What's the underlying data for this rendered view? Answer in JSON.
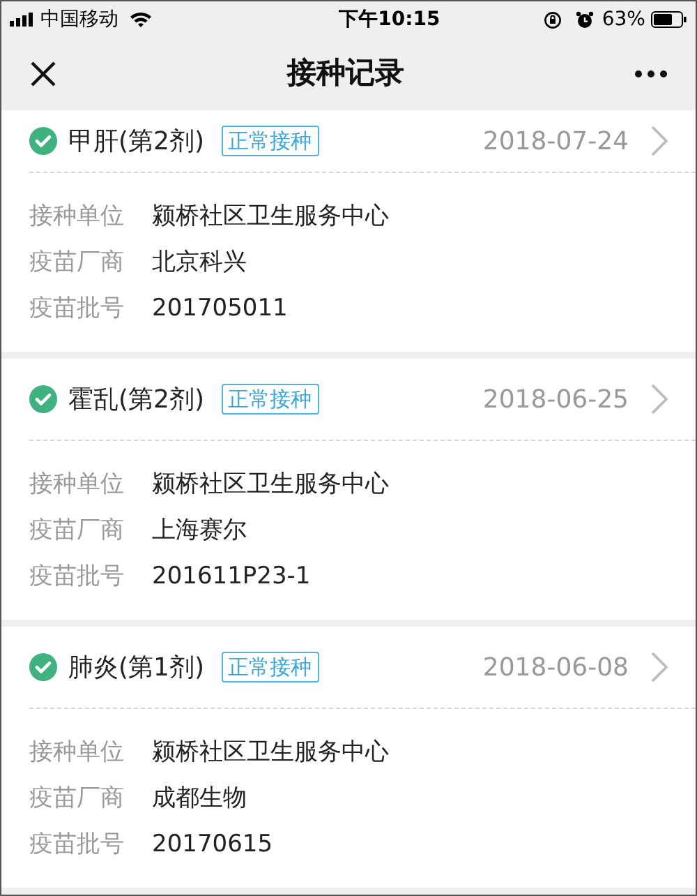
{
  "status_bar": {
    "carrier": "中国移动",
    "time": "下午10:15",
    "battery": "63%"
  },
  "nav": {
    "title": "接种记录"
  },
  "records": [
    {
      "name": "甲肝(第2剂)",
      "done": true,
      "tag": "正常接种",
      "date": "2018-07-24",
      "fields": [
        {
          "label": "接种单位",
          "value": "颍桥社区卫生服务中心"
        },
        {
          "label": "疫苗厂商",
          "value": "北京科兴"
        },
        {
          "label": "疫苗批号",
          "value": "201705011"
        }
      ]
    },
    {
      "name": "霍乱(第2剂)",
      "done": true,
      "tag": "正常接种",
      "date": "2018-06-25",
      "fields": [
        {
          "label": "接种单位",
          "value": "颍桥社区卫生服务中心"
        },
        {
          "label": "疫苗厂商",
          "value": "上海赛尔"
        },
        {
          "label": "疫苗批号",
          "value": "201611P23-1"
        }
      ]
    },
    {
      "name": "肺炎(第1剂)",
      "done": true,
      "tag": "正常接种",
      "date": "2018-06-08",
      "fields": [
        {
          "label": "接种单位",
          "value": "颍桥社区卫生服务中心"
        },
        {
          "label": "疫苗厂商",
          "value": "成都生物"
        },
        {
          "label": "疫苗批号",
          "value": "20170615"
        }
      ]
    }
  ]
}
